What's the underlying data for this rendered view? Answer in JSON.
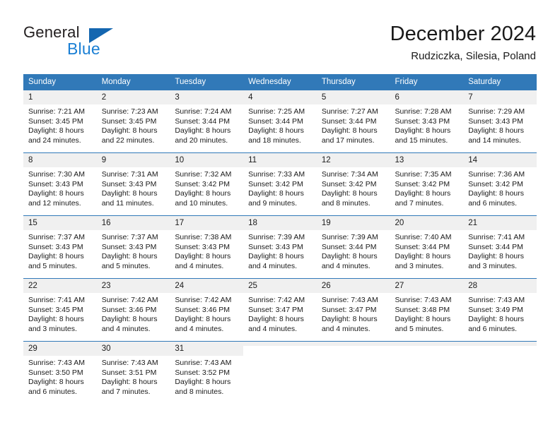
{
  "logo": {
    "word1": "General",
    "word2": "Blue",
    "triangle_color": "#1466b0",
    "word2_color": "#1a7fd4"
  },
  "header": {
    "title": "December 2024",
    "subtitle": "Rudziczka, Silesia, Poland"
  },
  "theme": {
    "header_bg": "#3179b8",
    "header_text": "#ffffff",
    "daynum_bg": "#f0f0f0",
    "row_divider": "#3179b8"
  },
  "weekday_headers": [
    "Sunday",
    "Monday",
    "Tuesday",
    "Wednesday",
    "Thursday",
    "Friday",
    "Saturday"
  ],
  "weeks": [
    [
      {
        "day": "1",
        "sunrise": "Sunrise: 7:21 AM",
        "sunset": "Sunset: 3:45 PM",
        "daylight1": "Daylight: 8 hours",
        "daylight2": "and 24 minutes."
      },
      {
        "day": "2",
        "sunrise": "Sunrise: 7:23 AM",
        "sunset": "Sunset: 3:45 PM",
        "daylight1": "Daylight: 8 hours",
        "daylight2": "and 22 minutes."
      },
      {
        "day": "3",
        "sunrise": "Sunrise: 7:24 AM",
        "sunset": "Sunset: 3:44 PM",
        "daylight1": "Daylight: 8 hours",
        "daylight2": "and 20 minutes."
      },
      {
        "day": "4",
        "sunrise": "Sunrise: 7:25 AM",
        "sunset": "Sunset: 3:44 PM",
        "daylight1": "Daylight: 8 hours",
        "daylight2": "and 18 minutes."
      },
      {
        "day": "5",
        "sunrise": "Sunrise: 7:27 AM",
        "sunset": "Sunset: 3:44 PM",
        "daylight1": "Daylight: 8 hours",
        "daylight2": "and 17 minutes."
      },
      {
        "day": "6",
        "sunrise": "Sunrise: 7:28 AM",
        "sunset": "Sunset: 3:43 PM",
        "daylight1": "Daylight: 8 hours",
        "daylight2": "and 15 minutes."
      },
      {
        "day": "7",
        "sunrise": "Sunrise: 7:29 AM",
        "sunset": "Sunset: 3:43 PM",
        "daylight1": "Daylight: 8 hours",
        "daylight2": "and 14 minutes."
      }
    ],
    [
      {
        "day": "8",
        "sunrise": "Sunrise: 7:30 AM",
        "sunset": "Sunset: 3:43 PM",
        "daylight1": "Daylight: 8 hours",
        "daylight2": "and 12 minutes."
      },
      {
        "day": "9",
        "sunrise": "Sunrise: 7:31 AM",
        "sunset": "Sunset: 3:43 PM",
        "daylight1": "Daylight: 8 hours",
        "daylight2": "and 11 minutes."
      },
      {
        "day": "10",
        "sunrise": "Sunrise: 7:32 AM",
        "sunset": "Sunset: 3:42 PM",
        "daylight1": "Daylight: 8 hours",
        "daylight2": "and 10 minutes."
      },
      {
        "day": "11",
        "sunrise": "Sunrise: 7:33 AM",
        "sunset": "Sunset: 3:42 PM",
        "daylight1": "Daylight: 8 hours",
        "daylight2": "and 9 minutes."
      },
      {
        "day": "12",
        "sunrise": "Sunrise: 7:34 AM",
        "sunset": "Sunset: 3:42 PM",
        "daylight1": "Daylight: 8 hours",
        "daylight2": "and 8 minutes."
      },
      {
        "day": "13",
        "sunrise": "Sunrise: 7:35 AM",
        "sunset": "Sunset: 3:42 PM",
        "daylight1": "Daylight: 8 hours",
        "daylight2": "and 7 minutes."
      },
      {
        "day": "14",
        "sunrise": "Sunrise: 7:36 AM",
        "sunset": "Sunset: 3:42 PM",
        "daylight1": "Daylight: 8 hours",
        "daylight2": "and 6 minutes."
      }
    ],
    [
      {
        "day": "15",
        "sunrise": "Sunrise: 7:37 AM",
        "sunset": "Sunset: 3:43 PM",
        "daylight1": "Daylight: 8 hours",
        "daylight2": "and 5 minutes."
      },
      {
        "day": "16",
        "sunrise": "Sunrise: 7:37 AM",
        "sunset": "Sunset: 3:43 PM",
        "daylight1": "Daylight: 8 hours",
        "daylight2": "and 5 minutes."
      },
      {
        "day": "17",
        "sunrise": "Sunrise: 7:38 AM",
        "sunset": "Sunset: 3:43 PM",
        "daylight1": "Daylight: 8 hours",
        "daylight2": "and 4 minutes."
      },
      {
        "day": "18",
        "sunrise": "Sunrise: 7:39 AM",
        "sunset": "Sunset: 3:43 PM",
        "daylight1": "Daylight: 8 hours",
        "daylight2": "and 4 minutes."
      },
      {
        "day": "19",
        "sunrise": "Sunrise: 7:39 AM",
        "sunset": "Sunset: 3:44 PM",
        "daylight1": "Daylight: 8 hours",
        "daylight2": "and 4 minutes."
      },
      {
        "day": "20",
        "sunrise": "Sunrise: 7:40 AM",
        "sunset": "Sunset: 3:44 PM",
        "daylight1": "Daylight: 8 hours",
        "daylight2": "and 3 minutes."
      },
      {
        "day": "21",
        "sunrise": "Sunrise: 7:41 AM",
        "sunset": "Sunset: 3:44 PM",
        "daylight1": "Daylight: 8 hours",
        "daylight2": "and 3 minutes."
      }
    ],
    [
      {
        "day": "22",
        "sunrise": "Sunrise: 7:41 AM",
        "sunset": "Sunset: 3:45 PM",
        "daylight1": "Daylight: 8 hours",
        "daylight2": "and 3 minutes."
      },
      {
        "day": "23",
        "sunrise": "Sunrise: 7:42 AM",
        "sunset": "Sunset: 3:46 PM",
        "daylight1": "Daylight: 8 hours",
        "daylight2": "and 4 minutes."
      },
      {
        "day": "24",
        "sunrise": "Sunrise: 7:42 AM",
        "sunset": "Sunset: 3:46 PM",
        "daylight1": "Daylight: 8 hours",
        "daylight2": "and 4 minutes."
      },
      {
        "day": "25",
        "sunrise": "Sunrise: 7:42 AM",
        "sunset": "Sunset: 3:47 PM",
        "daylight1": "Daylight: 8 hours",
        "daylight2": "and 4 minutes."
      },
      {
        "day": "26",
        "sunrise": "Sunrise: 7:43 AM",
        "sunset": "Sunset: 3:47 PM",
        "daylight1": "Daylight: 8 hours",
        "daylight2": "and 4 minutes."
      },
      {
        "day": "27",
        "sunrise": "Sunrise: 7:43 AM",
        "sunset": "Sunset: 3:48 PM",
        "daylight1": "Daylight: 8 hours",
        "daylight2": "and 5 minutes."
      },
      {
        "day": "28",
        "sunrise": "Sunrise: 7:43 AM",
        "sunset": "Sunset: 3:49 PM",
        "daylight1": "Daylight: 8 hours",
        "daylight2": "and 6 minutes."
      }
    ],
    [
      {
        "day": "29",
        "sunrise": "Sunrise: 7:43 AM",
        "sunset": "Sunset: 3:50 PM",
        "daylight1": "Daylight: 8 hours",
        "daylight2": "and 6 minutes."
      },
      {
        "day": "30",
        "sunrise": "Sunrise: 7:43 AM",
        "sunset": "Sunset: 3:51 PM",
        "daylight1": "Daylight: 8 hours",
        "daylight2": "and 7 minutes."
      },
      {
        "day": "31",
        "sunrise": "Sunrise: 7:43 AM",
        "sunset": "Sunset: 3:52 PM",
        "daylight1": "Daylight: 8 hours",
        "daylight2": "and 8 minutes."
      },
      {
        "day": "",
        "sunrise": "",
        "sunset": "",
        "daylight1": "",
        "daylight2": ""
      },
      {
        "day": "",
        "sunrise": "",
        "sunset": "",
        "daylight1": "",
        "daylight2": ""
      },
      {
        "day": "",
        "sunrise": "",
        "sunset": "",
        "daylight1": "",
        "daylight2": ""
      },
      {
        "day": "",
        "sunrise": "",
        "sunset": "",
        "daylight1": "",
        "daylight2": ""
      }
    ]
  ]
}
